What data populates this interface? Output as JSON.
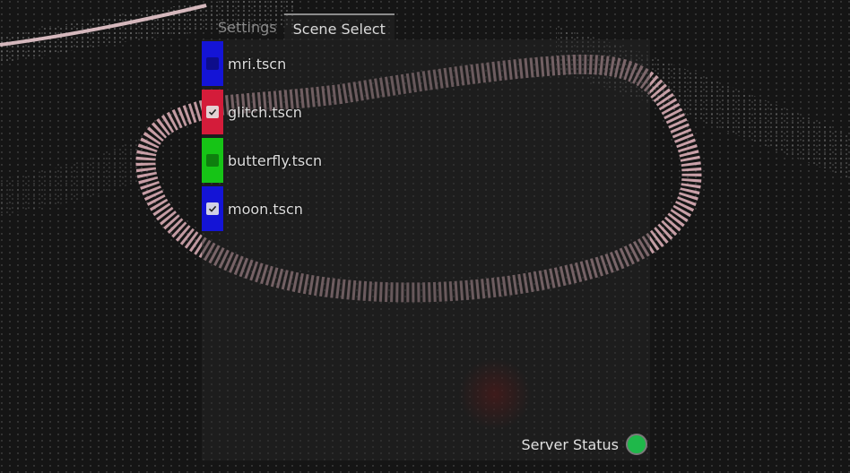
{
  "tabs": [
    {
      "label": "Settings",
      "active": false
    },
    {
      "label": "Scene Select",
      "active": true
    }
  ],
  "scenes": [
    {
      "label": "mri.tscn",
      "color": "#1414d6",
      "checked": false
    },
    {
      "label": "glitch.tscn",
      "color": "#d41c3a",
      "checked": true
    },
    {
      "label": "butterfly.tscn",
      "color": "#16c416",
      "checked": false
    },
    {
      "label": "moon.tscn",
      "color": "#1414d6",
      "checked": true
    }
  ],
  "status": {
    "label": "Server Status",
    "color": "#1fb84a"
  },
  "icons": {
    "checkbox_checked": "check-icon"
  }
}
